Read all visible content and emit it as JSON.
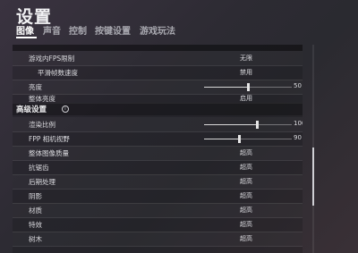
{
  "title": "设置",
  "tabs": [
    {
      "label": "图像",
      "active": true
    },
    {
      "label": "声音",
      "active": false
    },
    {
      "label": "控制",
      "active": false
    },
    {
      "label": "按键设置",
      "active": false
    },
    {
      "label": "游戏玩法",
      "active": false
    }
  ],
  "rows_top": [
    {
      "label": "游戏内FPS限制",
      "value": "无限"
    },
    {
      "label": "平滑帧数速度",
      "value": "禁用"
    },
    {
      "label": "亮度",
      "slider_fraction": 0.5,
      "number": "50"
    },
    {
      "label": "整体亮度",
      "value": "启用"
    }
  ],
  "advanced": {
    "title": "高级设置",
    "info_glyph": "i",
    "rows": [
      {
        "label": "渲染比例",
        "slider_fraction": 0.6,
        "number": "100"
      },
      {
        "label": "FPP 相机视野",
        "slider_fraction": 0.4,
        "number": "90"
      },
      {
        "label": "整体图像质量",
        "value": "超高"
      },
      {
        "label": "抗锯齿",
        "value": "超高"
      },
      {
        "label": "后期处理",
        "value": "超高"
      },
      {
        "label": "阴影",
        "value": "超高"
      },
      {
        "label": "材质",
        "value": "超高"
      },
      {
        "label": "特效",
        "value": "超高"
      },
      {
        "label": "树木",
        "value": "超高"
      }
    ]
  },
  "scrollbar": {
    "position_fraction": 0.5
  }
}
